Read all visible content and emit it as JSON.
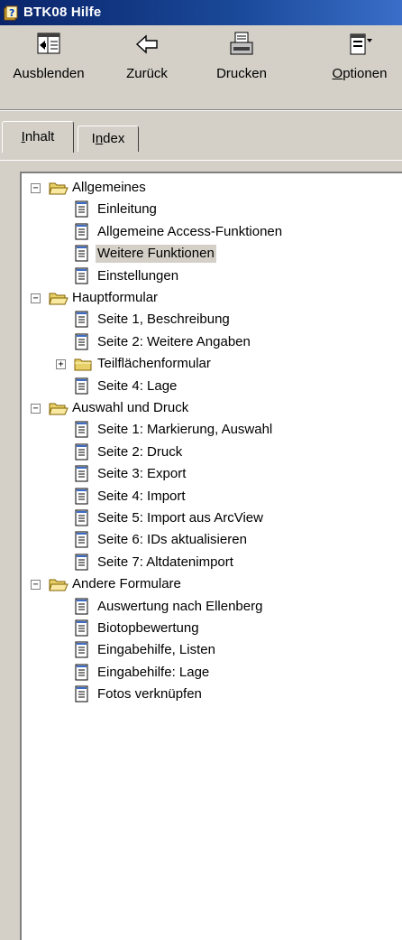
{
  "window": {
    "title": "BTK08 Hilfe"
  },
  "toolbar": {
    "buttons": [
      {
        "label": "Ausblenden",
        "icon": "hide-pane-icon"
      },
      {
        "label": "Zurück",
        "icon": "back-arrow-icon"
      },
      {
        "label": "Drucken",
        "icon": "printer-icon"
      },
      {
        "label": "Optionen",
        "icon": "options-icon"
      }
    ]
  },
  "tabs": [
    {
      "label": "Inhalt",
      "active": true
    },
    {
      "label": "Index",
      "active": false
    }
  ],
  "tree": [
    {
      "type": "folder",
      "label": "Allgemeines",
      "expanded": true,
      "children": [
        {
          "label": "Einleitung"
        },
        {
          "label": "Allgemeine Access-Funktionen"
        },
        {
          "label": "Weitere Funktionen",
          "selected": true
        },
        {
          "label": "Einstellungen"
        }
      ]
    },
    {
      "type": "folder",
      "label": "Hauptformular",
      "expanded": true,
      "children": [
        {
          "label": "Seite 1, Beschreibung"
        },
        {
          "label": "Seite 2: Weitere Angaben"
        },
        {
          "type": "folder",
          "label": "Teilflächenformular",
          "expanded": false
        },
        {
          "label": "Seite 4: Lage"
        }
      ]
    },
    {
      "type": "folder",
      "label": "Auswahl und Druck",
      "expanded": true,
      "children": [
        {
          "label": "Seite 1: Markierung, Auswahl"
        },
        {
          "label": "Seite 2: Druck"
        },
        {
          "label": "Seite 3: Export"
        },
        {
          "label": "Seite 4: Import"
        },
        {
          "label": "Seite 5: Import aus ArcView"
        },
        {
          "label": "Seite 6: IDs aktualisieren"
        },
        {
          "label": "Seite 7: Altdatenimport"
        }
      ]
    },
    {
      "type": "folder",
      "label": "Andere Formulare",
      "expanded": true,
      "children": [
        {
          "label": "Auswertung nach Ellenberg"
        },
        {
          "label": "Biotopbewertung"
        },
        {
          "label": "Eingabehilfe, Listen"
        },
        {
          "label": "Eingabehilfe: Lage"
        },
        {
          "label": "Fotos verknüpfen"
        }
      ]
    }
  ],
  "colors": {
    "selection": "#d4d0c8",
    "titlebar": "#0a246a",
    "folder": "#e8d068"
  }
}
